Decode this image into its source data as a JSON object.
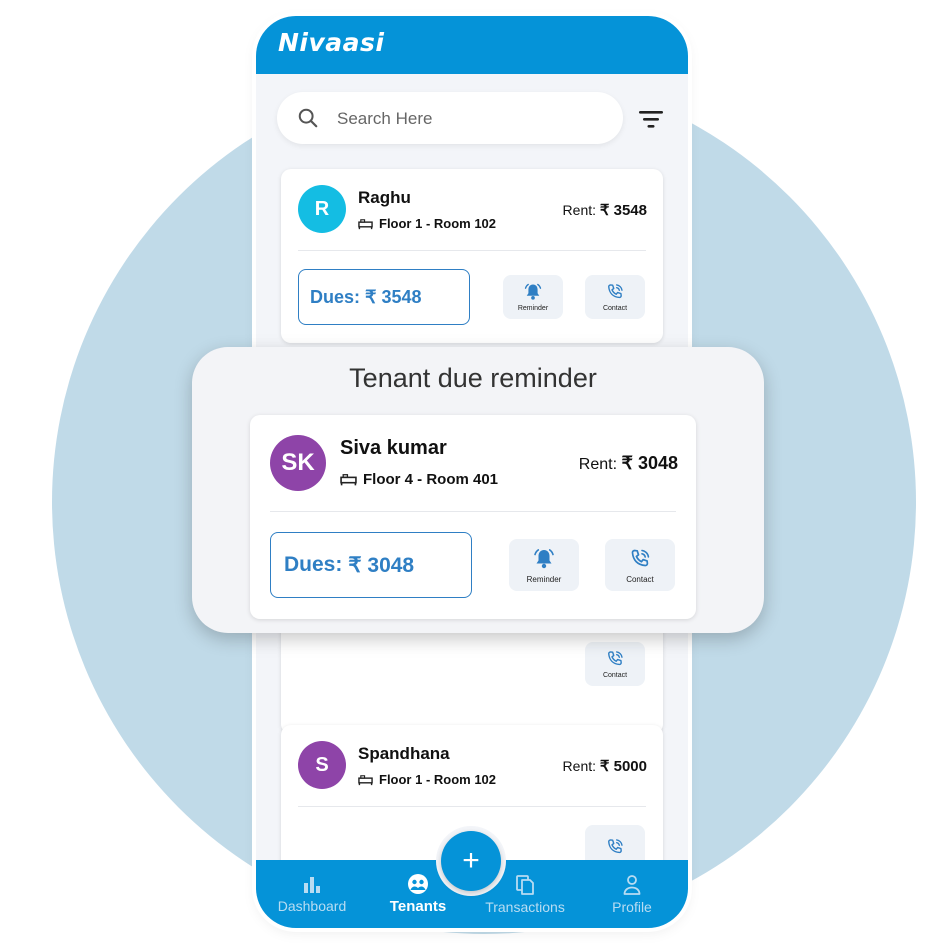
{
  "app": {
    "logo": "Nivaasi"
  },
  "search": {
    "placeholder": "Search Here"
  },
  "rent_prefix": "Rent:",
  "dues_prefix": "Dues:",
  "actions": {
    "reminder": "Reminder",
    "contact": "Contact"
  },
  "tenants": [
    {
      "initials": "R",
      "name": "Raghu",
      "room": "Floor 1 - Room 102",
      "rent": "₹ 3548",
      "dues": "₹ 3548",
      "avatar_color": "#14bde3"
    },
    {
      "initials": "S",
      "name": "Spandhana",
      "room": "Floor 1 - Room 102",
      "rent": "₹ 5000",
      "avatar_color": "#8e44a8"
    }
  ],
  "reminder_popup": {
    "title": "Tenant due reminder",
    "tenant": {
      "initials": "SK",
      "name": "Siva kumar",
      "room": "Floor 4 - Room 401",
      "rent": "₹ 3048",
      "dues": "₹ 3048",
      "avatar_color": "#8e44a8"
    }
  },
  "nav": {
    "items": [
      {
        "label": "Dashboard",
        "icon": "bar-chart-icon"
      },
      {
        "label": "Tenants",
        "icon": "tenants-icon",
        "active": true
      },
      {
        "label": "Transactions",
        "icon": "documents-icon"
      },
      {
        "label": "Profile",
        "icon": "user-icon"
      }
    ],
    "fab": "+"
  },
  "colors": {
    "primary": "#0593d8",
    "accent_blue": "#2f7fc4",
    "background_circle": "#c0dae8"
  }
}
